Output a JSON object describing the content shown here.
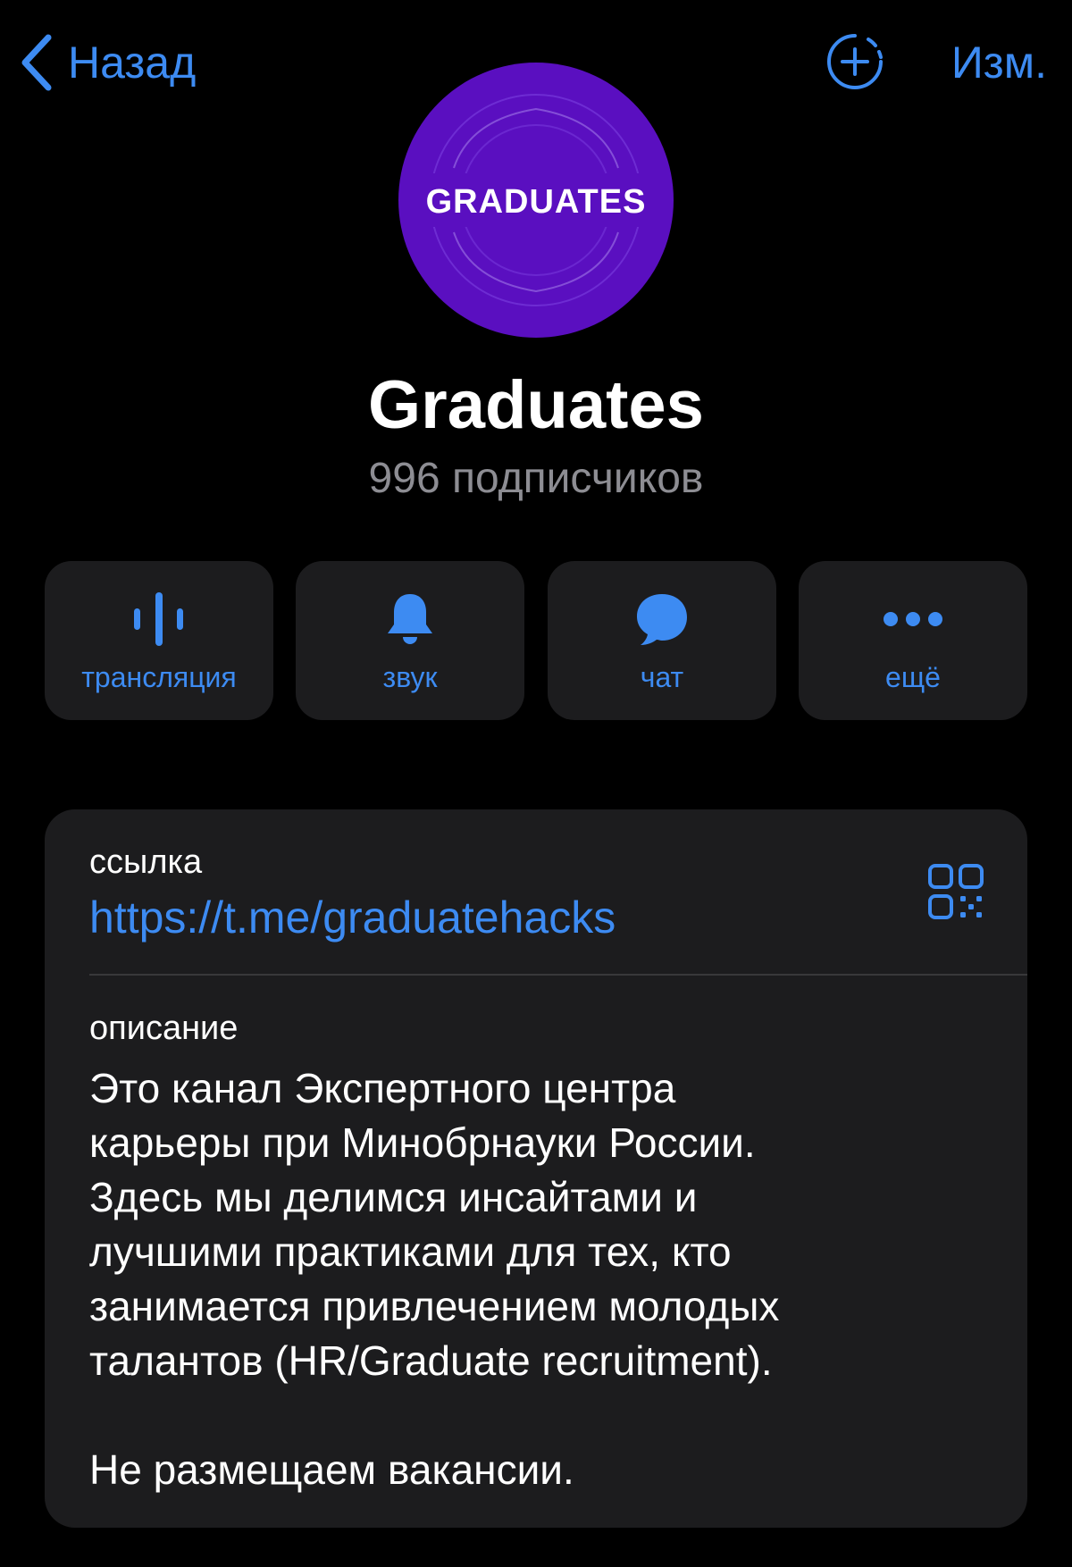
{
  "nav": {
    "back_label": "Назад",
    "edit_label": "Изм."
  },
  "channel": {
    "avatar_text": "GRADUATES",
    "name": "Graduates",
    "subscribers": "996 подписчиков"
  },
  "actions": [
    {
      "label": "трансляция",
      "icon": "live-stream-icon"
    },
    {
      "label": "звук",
      "icon": "bell-icon"
    },
    {
      "label": "чат",
      "icon": "chat-bubble-icon"
    },
    {
      "label": "ещё",
      "icon": "more-dots-icon"
    }
  ],
  "info": {
    "link_label": "ссылка",
    "link_value": "https://t.me/graduatehacks",
    "description_label": "описание",
    "description": "Это канал Экспертного центра\nкарьеры при Минобрнауки России.\nЗдесь мы делимся инсайтами и\nлучшими практиками для тех, кто\nзанимается привлечением молодых\nталантов (HR/Graduate recruitment).\n\nНе размещаем вакансии."
  },
  "colors": {
    "accent": "#3d8bf2",
    "background": "#000000",
    "card": "#1c1c1e",
    "secondary_text": "#8d8d93",
    "avatar": "#5a0fc0"
  }
}
